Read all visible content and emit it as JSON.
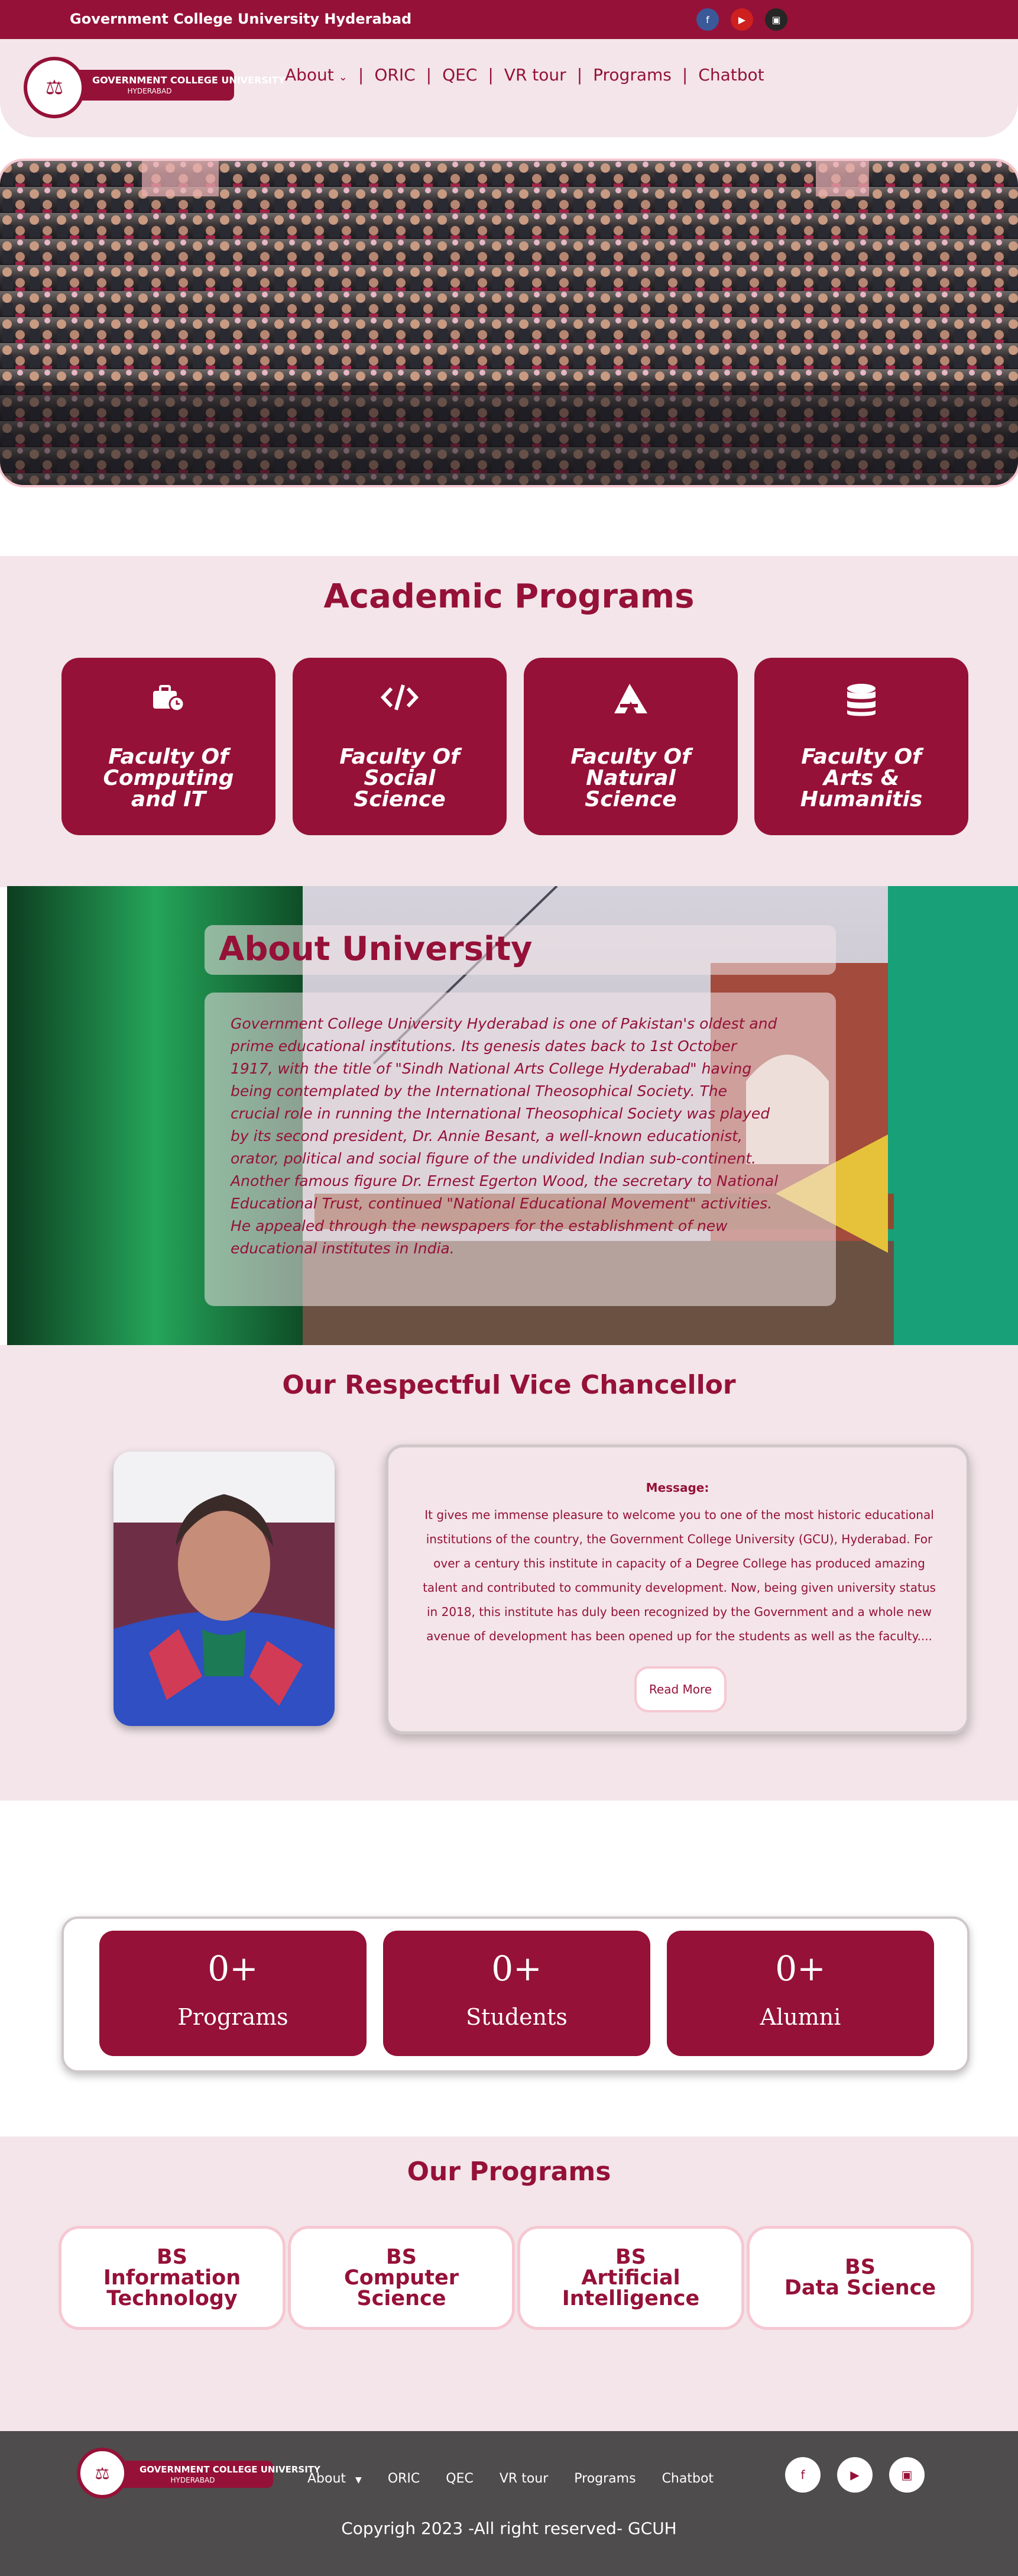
{
  "topbar": {
    "university_name": "Government College University Hyderabad",
    "social": [
      {
        "icon": "facebook-icon"
      },
      {
        "icon": "youtube-icon"
      },
      {
        "icon": "instagram-icon"
      }
    ]
  },
  "logo": {
    "line1": "GOVERNMENT COLLEGE UNIVERSITY",
    "line2": "HYDERABAD"
  },
  "nav": {
    "items": [
      "About",
      "ORIC",
      "QEC",
      "VR tour",
      "Programs",
      "Chatbot"
    ]
  },
  "academic": {
    "title": "Academic Programs",
    "faculties": [
      {
        "icon": "briefcase-clock-icon",
        "line1": "Faculty Of",
        "line2": "Computing",
        "line3": "and IT"
      },
      {
        "icon": "code-icon",
        "line1": "Faculty Of",
        "line2": "Social",
        "line3": "Science"
      },
      {
        "icon": "letter-a-icon",
        "line1": "Faculty Of",
        "line2": "Natural",
        "line3": "Science"
      },
      {
        "icon": "database-icon",
        "line1": "Faculty Of",
        "line2": "Arts &",
        "line3": "Humanitis"
      }
    ]
  },
  "about": {
    "title": "About University",
    "text": "Government College University Hyderabad is one of Pakistan's oldest and prime educational institutions. Its genesis dates back to 1st October 1917, with the title of \"Sindh National Arts College Hyderabad\" having being contemplated by the International Theosophical Society. The crucial role in running the International Theosophical Society was played by its second president, Dr. Annie Besant, a well-known educationist, orator, political and social figure of the undivided Indian sub-continent. Another famous figure Dr. Ernest Egerton Wood, the secretary to National Educational Trust, continued \"National Educational Movement\" activities. He appealed through the newspapers for the establishment of new educational institutes in India."
  },
  "vc": {
    "title": "Our Respectful Vice Chancellor",
    "message_label": "Message:",
    "message": "It gives me immense pleasure to welcome you to one of the most historic educational institutions of the country, the Government College University (GCU), Hyderabad. For over a century this institute in capacity of a Degree College has produced amazing talent and contributed to community development. Now, being given university status in 2018, this institute has duly been recognized by the Government and a whole new avenue of development has been opened up for the students as well as the faculty....",
    "read_more": "Read More"
  },
  "stats": [
    {
      "value": "0+",
      "label": "Programs"
    },
    {
      "value": "0+",
      "label": "Students"
    },
    {
      "value": "0+",
      "label": "Alumni"
    }
  ],
  "programs": {
    "title": "Our Programs",
    "items": [
      {
        "line1": "BS",
        "line2": "Information",
        "line3": "Technology"
      },
      {
        "line1": "BS",
        "line2": "Computer",
        "line3": "Science"
      },
      {
        "line1": "BS",
        "line2": "Artificial",
        "line3": "Intelligence"
      },
      {
        "line1": "BS",
        "line2": "Data Science",
        "line3": ""
      }
    ]
  },
  "footer": {
    "nav": [
      "About",
      "ORIC",
      "QEC",
      "VR tour",
      "Programs",
      "Chatbot"
    ],
    "copyright": "Copyrigh 2023 -All right reserved- GCUH"
  },
  "colors": {
    "brand": "#951138",
    "light_bg": "#f3e5e9",
    "footer_bg": "#4e4c4c"
  }
}
